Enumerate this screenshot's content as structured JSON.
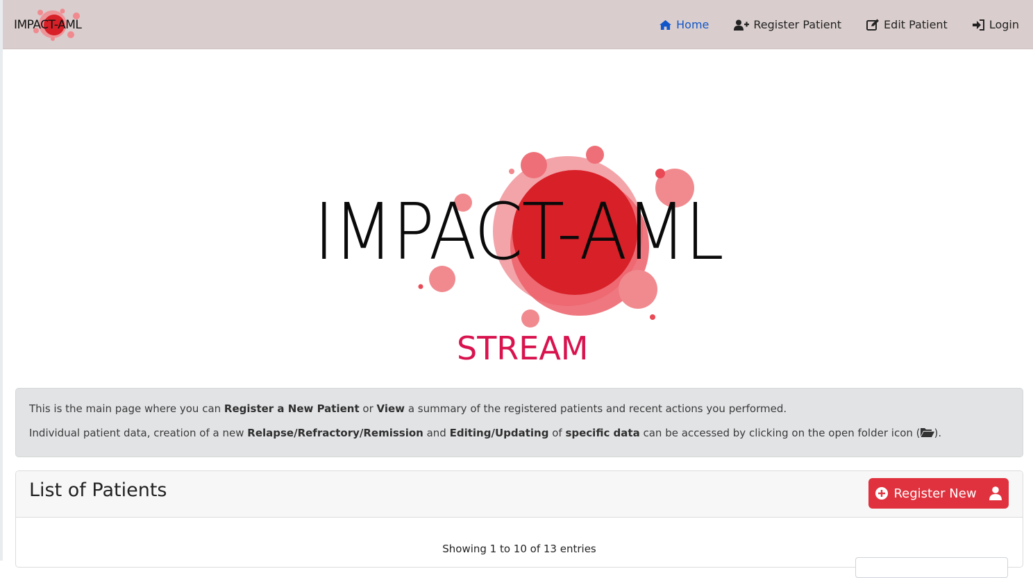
{
  "navbar": {
    "brand": "IMPACT-AML",
    "items": [
      {
        "label": "Home",
        "icon": "home-icon",
        "active": true
      },
      {
        "label": "Register Patient",
        "icon": "user-plus-icon",
        "active": false
      },
      {
        "label": "Edit Patient",
        "icon": "edit-icon",
        "active": false
      },
      {
        "label": "Login",
        "icon": "sign-in-icon",
        "active": false
      }
    ]
  },
  "hero": {
    "title": "IMPACT-AML",
    "subtitle": "STREAM"
  },
  "info": {
    "line1": {
      "t1": "This is the main page where you can ",
      "b1": "Register a New Patient",
      "t2": " or ",
      "b2": "View",
      "t3": " a summary of the registered patients and recent actions you performed."
    },
    "line2": {
      "t1": "Individual patient data, creation of a new ",
      "b1": "Relapse/Refractory/Remission",
      "t2": " and ",
      "b2": "Editing/Updating",
      "t3": " of ",
      "b3": "specific data",
      "t4": " can be accessed by clicking on the open folder icon (",
      "t5": ")."
    }
  },
  "patients": {
    "title": "List of Patients",
    "register_button": "Register New",
    "entries_info": "Showing 1 to 10 of 13 entries"
  },
  "colors": {
    "navbar_bg": "#d9cdcd",
    "active_link": "#1257c9",
    "brand_red": "#d72027",
    "stream_pink": "#d8134e",
    "button_red": "#e0323e"
  }
}
